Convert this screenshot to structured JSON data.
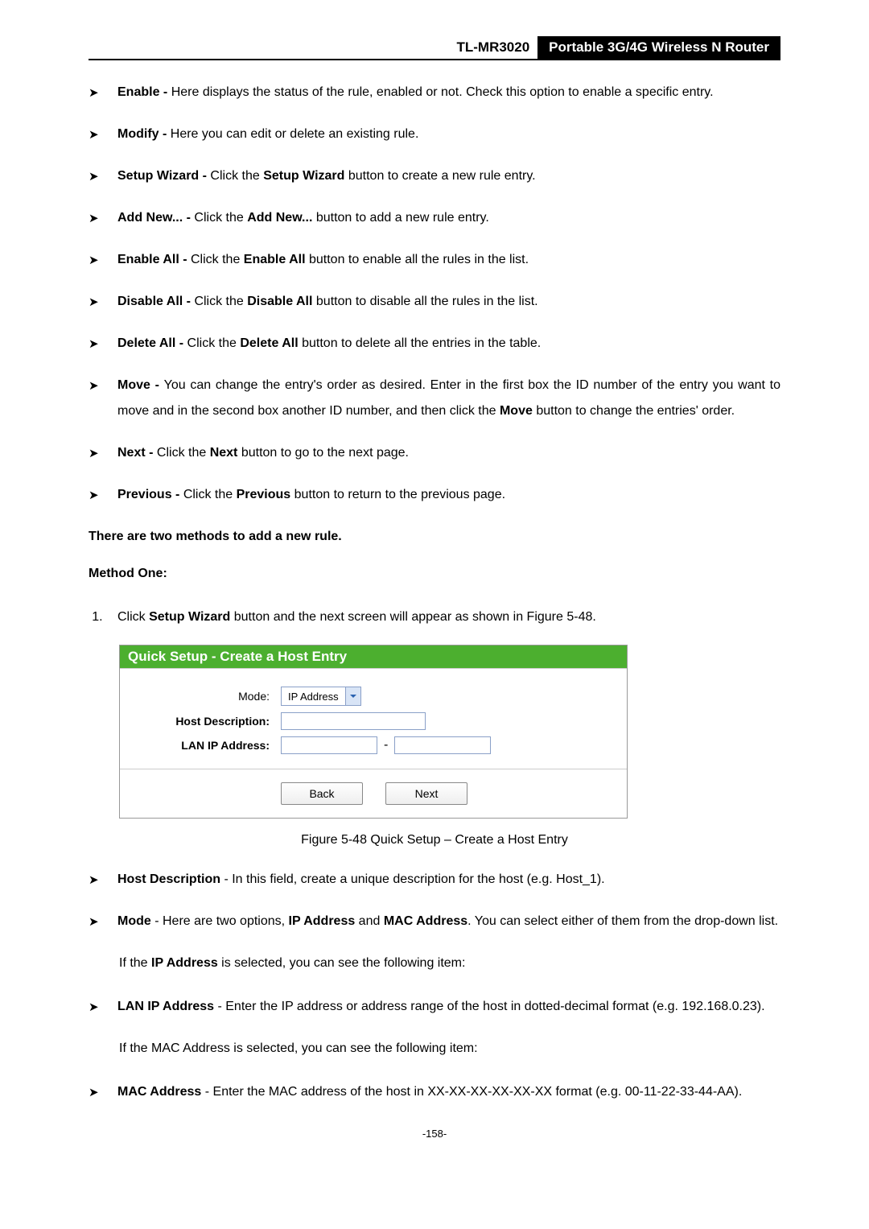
{
  "header": {
    "model": "TL-MR3020",
    "product": "Portable 3G/4G Wireless N Router"
  },
  "bullets1": [
    {
      "term": "Enable",
      "sep": " - ",
      "desc": "Here displays the status of the rule, enabled or not. Check this option to enable a specific entry."
    },
    {
      "term": "Modify",
      "sep": " - ",
      "desc": "Here you can edit or delete an existing rule."
    },
    {
      "term": "Setup Wizard",
      "sep": " - ",
      "desc_pre": "Click the ",
      "mid_bold": "Setup Wizard",
      "desc_post": " button to create a new rule entry."
    },
    {
      "term": "Add New...",
      "sep": "   - ",
      "desc_pre": "Click the ",
      "mid_bold": "Add New...",
      "desc_post": " button to add a new rule entry."
    },
    {
      "term": "Enable All",
      "sep": " - ",
      "desc_pre": "Click the ",
      "mid_bold": "Enable All",
      "desc_post": " button to enable all the rules in the list."
    },
    {
      "term": "Disable All",
      "sep": " - ",
      "desc_pre": "Click the ",
      "mid_bold": "Disable All",
      "desc_post": " button to disable all the rules in the list."
    },
    {
      "term": "Delete All",
      "sep": " - ",
      "desc_pre": "Click the ",
      "mid_bold": "Delete All",
      "desc_post": " button to delete all the entries in the table."
    },
    {
      "term": "Move",
      "sep": " - ",
      "desc_pre": "You can change the entry's order as desired. Enter in the first box the ID number of the entry you want to move and in the second box another ID number, and then click the ",
      "mid_bold": "Move",
      "desc_post": " button to change the entries' order."
    },
    {
      "term": "Next",
      "sep": " - ",
      "desc_pre": "Click the ",
      "mid_bold": "Next",
      "desc_post": " button to go to the next page."
    },
    {
      "term": "Previous",
      "sep": " - ",
      "desc_pre": "Click the ",
      "mid_bold": "Previous",
      "desc_post": " button to return to the previous page."
    }
  ],
  "methods_intro": "There are two methods to add a new rule.",
  "method_one": "Method One:",
  "step1_pre": "Click ",
  "step1_bold": "Setup Wizard",
  "step1_mid": " button and the next screen will appear as shown in ",
  "step1_ref": "Figure 5-48",
  "step1_post": ".",
  "figure": {
    "title": "Quick Setup - Create a Host Entry",
    "labels": {
      "mode": "Mode:",
      "host_desc": "Host Description:",
      "lan_ip": "LAN IP Address:"
    },
    "mode_value": "IP Address",
    "buttons": {
      "back": "Back",
      "next": "Next"
    }
  },
  "caption": "Figure 5-48    Quick Setup – Create a Host Entry",
  "bullets2": [
    {
      "term": "Host Description",
      "sep": " - ",
      "desc": "In this field, create a unique description for the host (e.g. Host_1)."
    },
    {
      "term": "Mode",
      "sep": " - ",
      "pre": "Here are two options, ",
      "b1": "IP Address",
      "mid": " and ",
      "b2": "MAC Address",
      "post": ". You can select either of them from the drop-down list."
    }
  ],
  "cond1_pre": "If the ",
  "cond1_bold": "IP Address",
  "cond1_post": " is selected, you can see the following item:",
  "bullets3": [
    {
      "term": "LAN IP Address",
      "sep": " - ",
      "desc": "Enter the IP address or address range of the host in dotted-decimal format (e.g. 192.168.0.23)."
    }
  ],
  "cond2": "If the MAC Address is selected, you can see the following item:",
  "bullets4": [
    {
      "term": "MAC Address",
      "sep": " - ",
      "desc": "Enter the MAC address of the host in XX-XX-XX-XX-XX-XX format (e.g. 00-11-22-33-44-AA)."
    }
  ],
  "page_num": "-158-"
}
